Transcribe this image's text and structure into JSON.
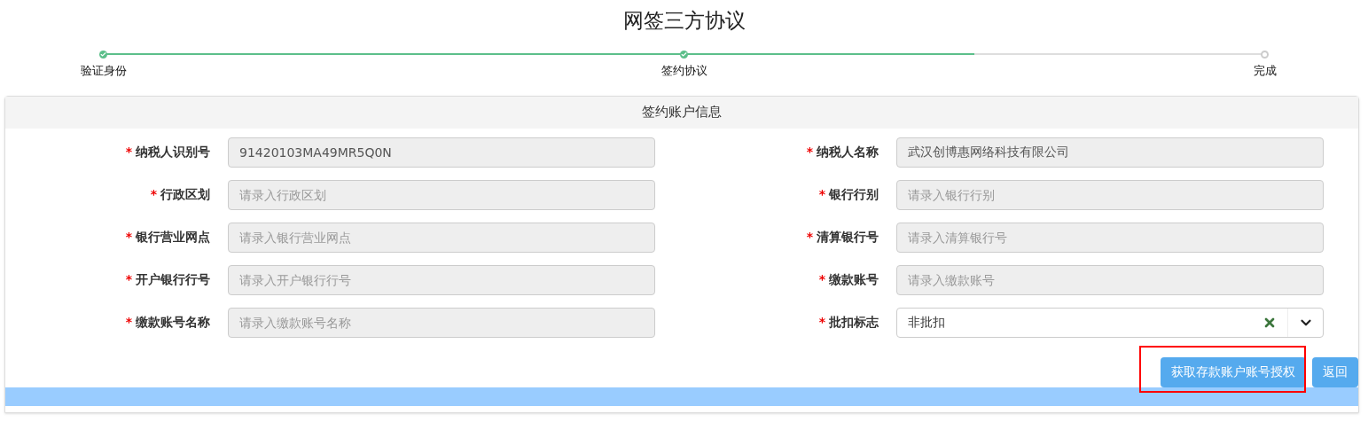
{
  "title": "网签三方协议",
  "progress": {
    "level": 0.75,
    "steps": [
      {
        "label": "验证身份",
        "done": true
      },
      {
        "label": "签约协议",
        "done": true
      },
      {
        "label": "完成",
        "done": false
      }
    ]
  },
  "section_title": "签约账户信息",
  "fields": [
    {
      "required_mark": "*",
      "label": "纳税人识别号",
      "kind": "text",
      "value": "91420103MA49MR5Q0N"
    },
    {
      "required_mark": "*",
      "label": "纳税人名称",
      "kind": "text",
      "value": "武汉创博惠网络科技有限公司"
    },
    {
      "required_mark": "*",
      "label": "行政区划",
      "kind": "text",
      "placeholder": "请录入行政区划"
    },
    {
      "required_mark": "*",
      "label": "银行行别",
      "kind": "text",
      "placeholder": "请录入银行行别"
    },
    {
      "required_mark": "*",
      "label": "银行营业网点",
      "kind": "text",
      "placeholder": "请录入银行营业网点"
    },
    {
      "required_mark": "*",
      "label": "清算银行号",
      "kind": "text",
      "placeholder": "请录入清算银行号"
    },
    {
      "required_mark": "*",
      "label": "开户银行行号",
      "kind": "text",
      "placeholder": "请录入开户银行行号"
    },
    {
      "required_mark": "*",
      "label": "缴款账号",
      "kind": "text",
      "placeholder": "请录入缴款账号"
    },
    {
      "required_mark": "*",
      "label": "缴款账号名称",
      "kind": "text",
      "placeholder": "请录入缴款账号名称"
    },
    {
      "required_mark": "*",
      "label": "批扣标志",
      "kind": "select",
      "value": "非批扣"
    }
  ],
  "buttons": [
    {
      "label": "获取存款账户账号授权",
      "highlighted": true
    },
    {
      "label": "返回",
      "highlighted": false
    }
  ]
}
